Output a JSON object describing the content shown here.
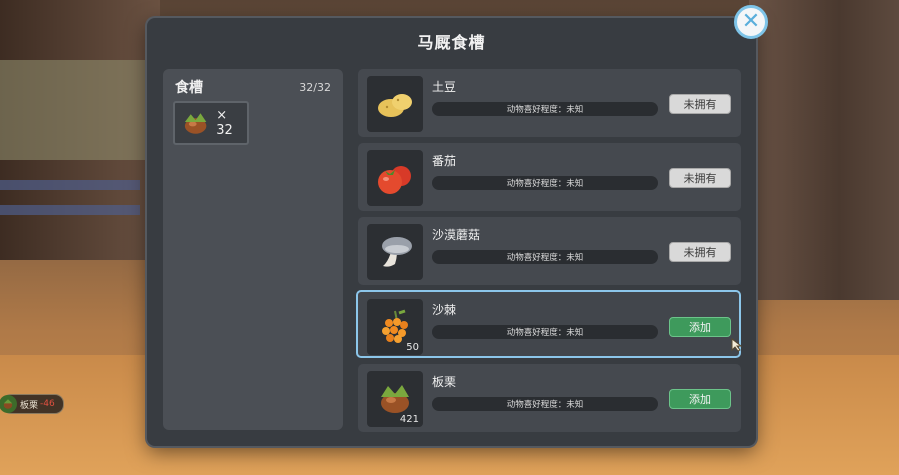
{
  "dialog": {
    "title": "马厩食槽",
    "close_icon": "close-icon"
  },
  "trough": {
    "title": "食槽",
    "count": "32/32",
    "slot": {
      "icon": "chestnut-icon",
      "quantity": "× 32"
    }
  },
  "foods": [
    {
      "name": "土豆",
      "icon": "potato-icon",
      "preference": "动物喜好程度：未知",
      "button": "未拥有",
      "button_state": "unavailable",
      "quantity": ""
    },
    {
      "name": "番茄",
      "icon": "tomato-icon",
      "preference": "动物喜好程度：未知",
      "button": "未拥有",
      "button_state": "unavailable",
      "quantity": ""
    },
    {
      "name": "沙漠蘑菇",
      "icon": "mushroom-icon",
      "preference": "动物喜好程度：未知",
      "button": "未拥有",
      "button_state": "unavailable",
      "quantity": ""
    },
    {
      "name": "沙棘",
      "icon": "sea-buckthorn-icon",
      "preference": "动物喜好程度：未知",
      "button": "添加",
      "button_state": "available",
      "quantity": "50"
    },
    {
      "name": "板栗",
      "icon": "chestnut-icon",
      "preference": "动物喜好程度：未知",
      "button": "添加",
      "button_state": "available",
      "quantity": "421"
    }
  ],
  "hud": {
    "label": "板栗",
    "value": "-46"
  },
  "colors": {
    "panel": "#383c41",
    "accent": "#8cc6ea",
    "add_button": "#3e9a5c",
    "locked_button": "#d9d9d9"
  }
}
